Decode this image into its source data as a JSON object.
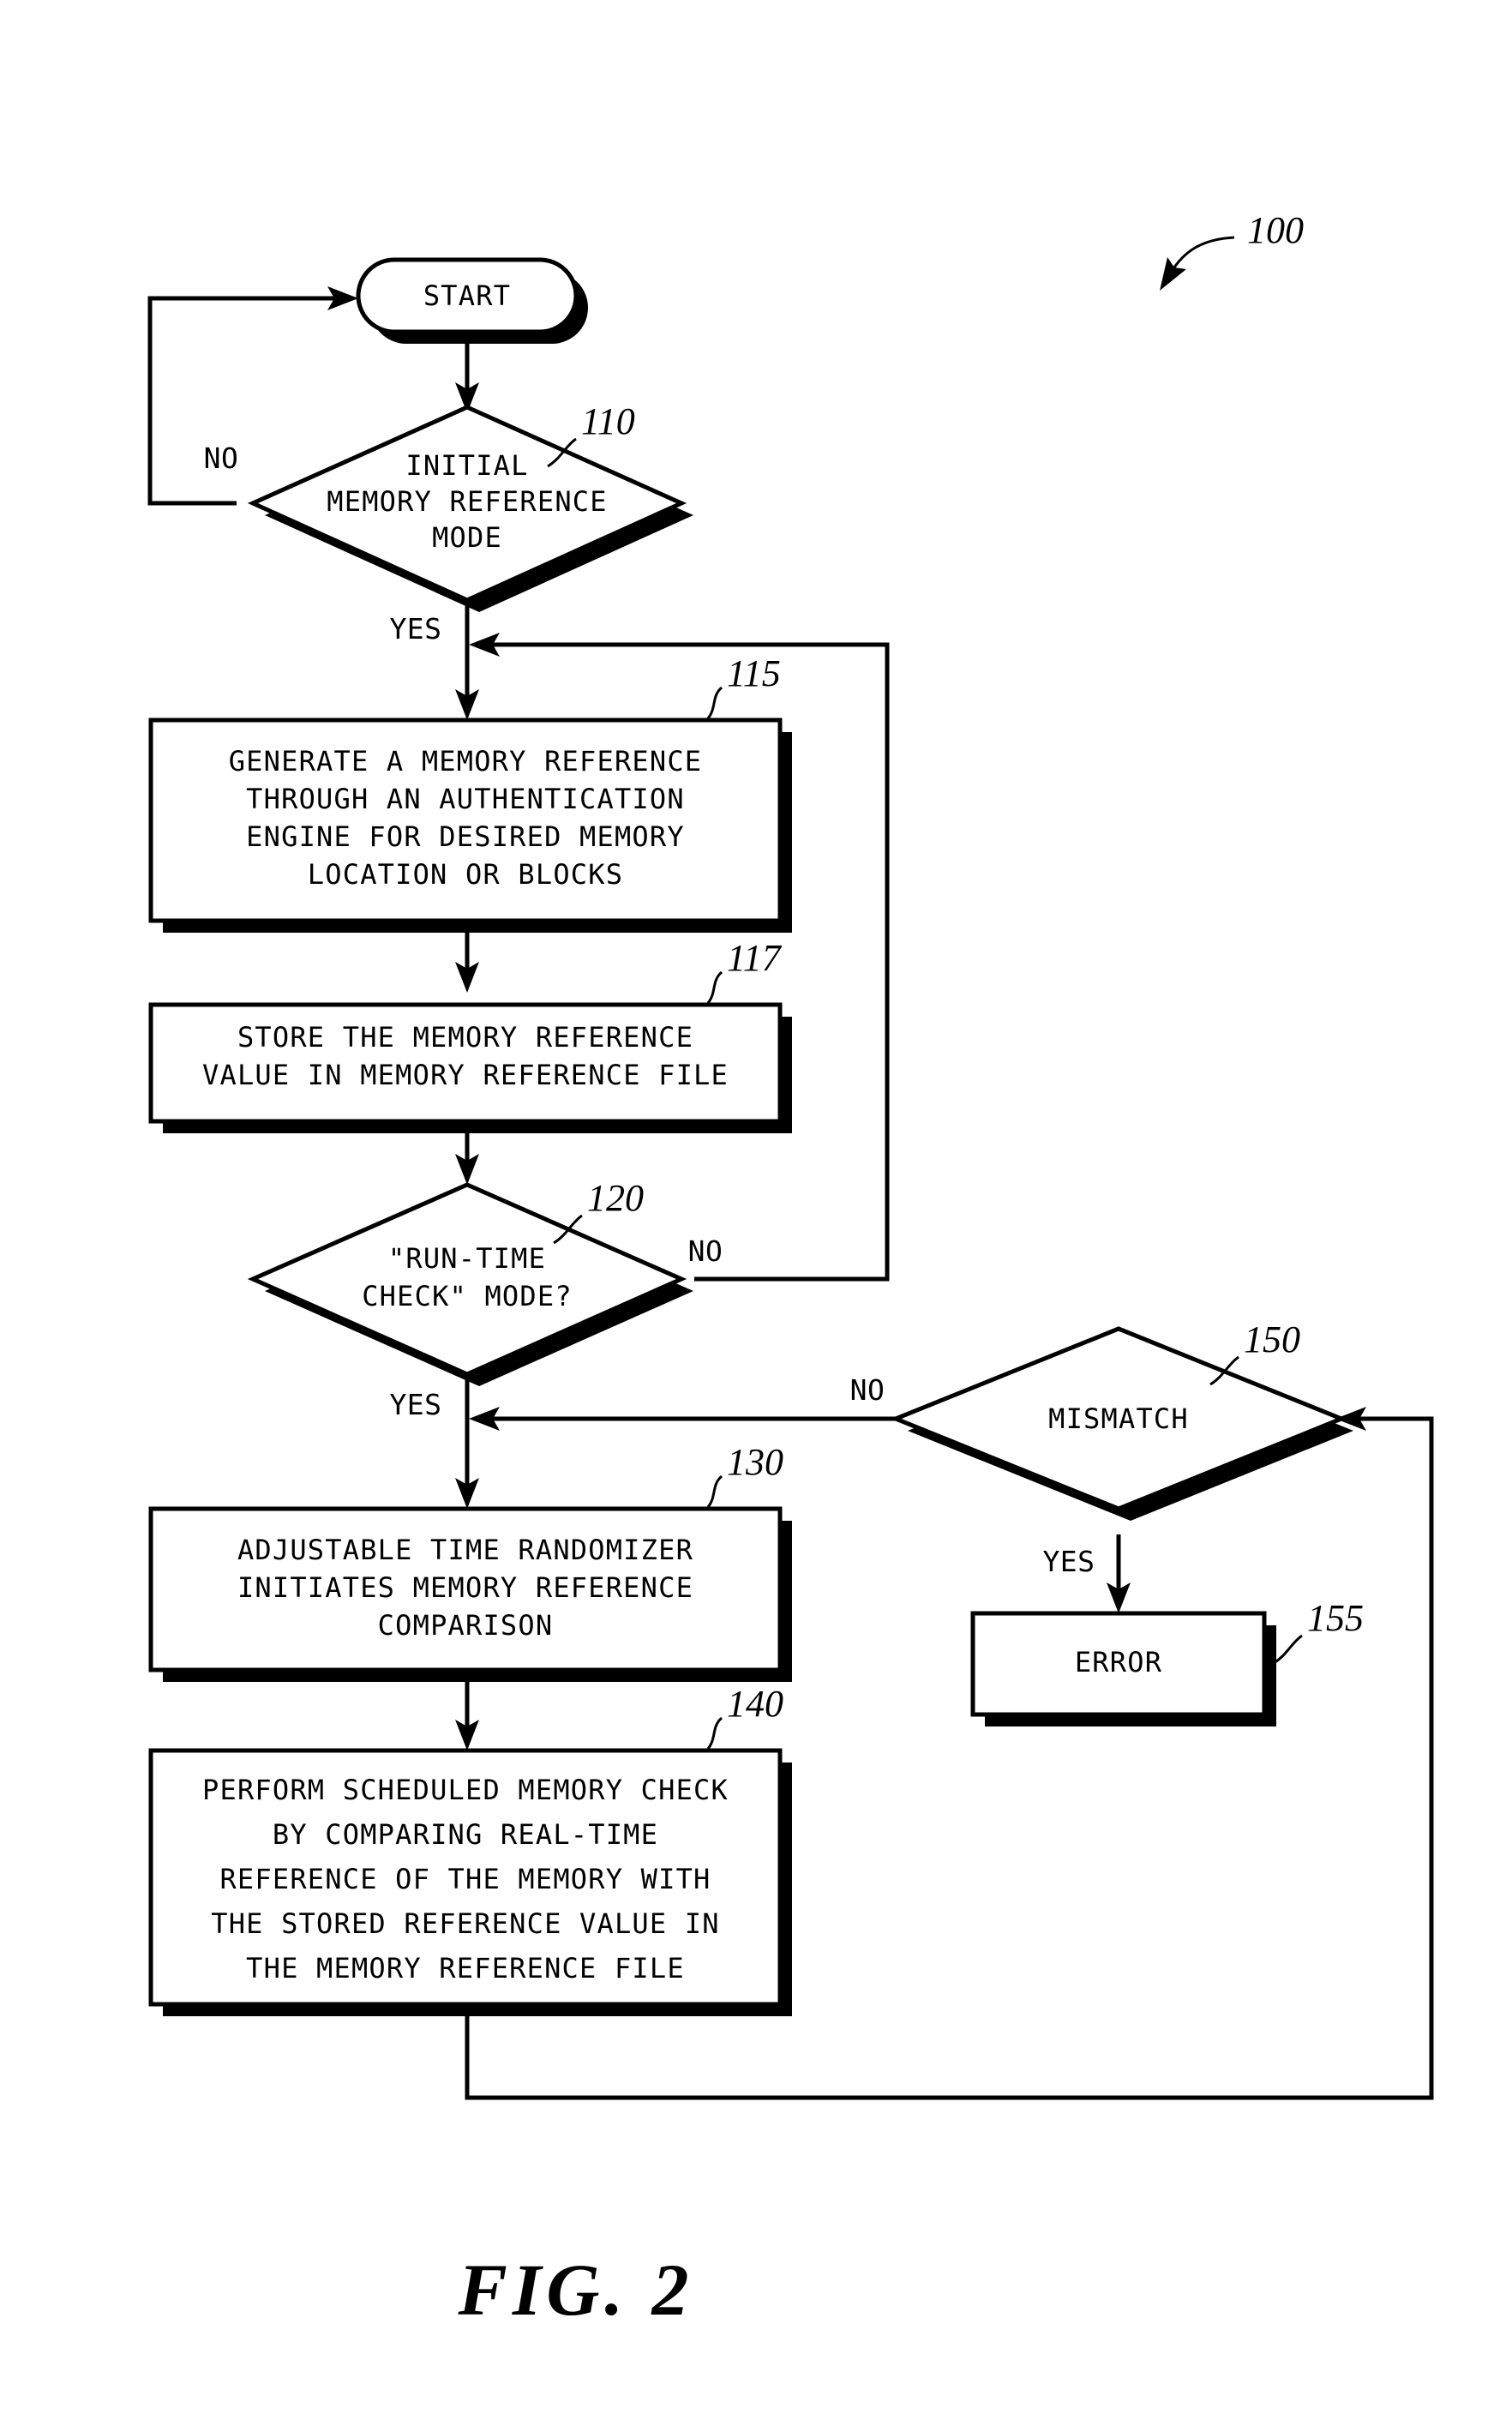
{
  "figure": {
    "caption": "FIG. 2",
    "overall_ref": "100"
  },
  "nodes": {
    "start": {
      "ref": "",
      "label": "START",
      "shape": "terminator"
    },
    "initial_mode": {
      "ref": "110",
      "shape": "decision",
      "lines": [
        "INITIAL",
        "MEMORY REFERENCE",
        "MODE"
      ]
    },
    "generate_reference": {
      "ref": "115",
      "shape": "process",
      "lines": [
        "GENERATE A MEMORY REFERENCE",
        "THROUGH AN AUTHENTICATION",
        "ENGINE FOR DESIRED MEMORY",
        "LOCATION OR BLOCKS"
      ]
    },
    "store_reference": {
      "ref": "117",
      "shape": "process",
      "lines": [
        "STORE THE MEMORY REFERENCE",
        "VALUE IN MEMORY REFERENCE FILE"
      ]
    },
    "runtime_check": {
      "ref": "120",
      "shape": "decision",
      "lines": [
        "\"RUN-TIME",
        "CHECK\" MODE?"
      ]
    },
    "randomizer": {
      "ref": "130",
      "shape": "process",
      "lines": [
        "ADJUSTABLE TIME RANDOMIZER",
        "INITIATES MEMORY REFERENCE",
        "COMPARISON"
      ]
    },
    "perform_check": {
      "ref": "140",
      "shape": "process",
      "lines": [
        "PERFORM SCHEDULED MEMORY CHECK",
        "BY COMPARING REAL-TIME",
        "REFERENCE OF THE MEMORY WITH",
        "THE STORED REFERENCE VALUE IN",
        "THE MEMORY REFERENCE FILE"
      ]
    },
    "mismatch": {
      "ref": "150",
      "shape": "decision",
      "lines": [
        "MISMATCH"
      ]
    },
    "error": {
      "ref": "155",
      "shape": "process",
      "lines": [
        "ERROR"
      ]
    }
  },
  "edge_labels": {
    "initial_mode_no": "NO",
    "initial_mode_yes": "YES",
    "runtime_check_no": "NO",
    "runtime_check_yes": "YES",
    "mismatch_no": "NO",
    "mismatch_yes": "YES"
  }
}
